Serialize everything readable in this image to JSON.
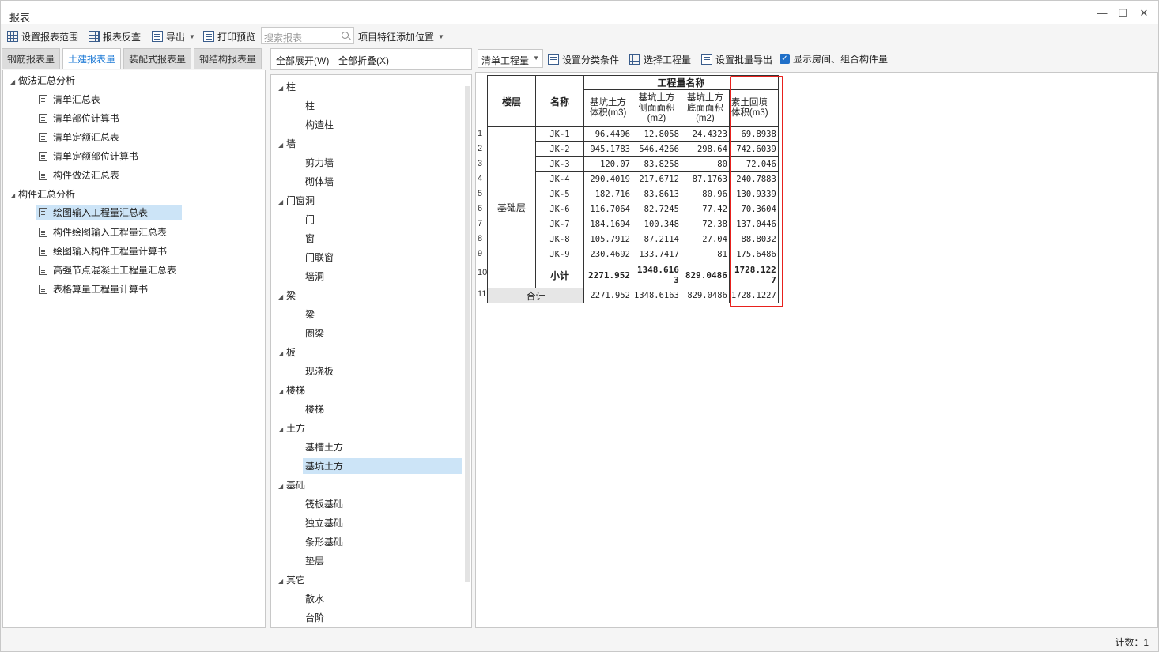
{
  "window": {
    "title": "报表",
    "minimize": "—",
    "maximize": "☐",
    "close": "✕"
  },
  "toolbar": {
    "set_range": "设置报表范围",
    "reverse_check": "报表反查",
    "export": "导出",
    "print_preview": "打印预览",
    "search_placeholder": "搜索报表",
    "add_feature_position": "项目特征添加位置"
  },
  "left_tabs": [
    "钢筋报表量",
    "土建报表量",
    "装配式报表量",
    "钢结构报表量"
  ],
  "left_tree": {
    "group1": "做法汇总分析",
    "group1_items": [
      "清单汇总表",
      "清单部位计算书",
      "清单定额汇总表",
      "清单定额部位计算书",
      "构件做法汇总表"
    ],
    "group2": "构件汇总分析",
    "group2_items": [
      "绘图输入工程量汇总表",
      "构件绘图输入工程量汇总表",
      "绘图输入构件工程量计算书",
      "高强节点混凝土工程量汇总表",
      "表格算量工程量计算书"
    ]
  },
  "middle": {
    "expand_all": "全部展开(W)",
    "collapse_all": "全部折叠(X)",
    "tree": [
      {
        "label": "柱",
        "children": [
          "柱",
          "构造柱"
        ]
      },
      {
        "label": "墙",
        "children": [
          "剪力墙",
          "砌体墙"
        ]
      },
      {
        "label": "门窗洞",
        "children": [
          "门",
          "窗",
          "门联窗",
          "墙洞"
        ]
      },
      {
        "label": "梁",
        "children": [
          "梁",
          "圈梁"
        ]
      },
      {
        "label": "板",
        "children": [
          "现浇板"
        ]
      },
      {
        "label": "楼梯",
        "children": [
          "楼梯"
        ]
      },
      {
        "label": "土方",
        "children": [
          "基槽土方",
          "基坑土方"
        ]
      },
      {
        "label": "基础",
        "children": [
          "筏板基础",
          "独立基础",
          "条形基础",
          "垫层"
        ]
      },
      {
        "label": "其它",
        "children": [
          "散水",
          "台阶"
        ]
      }
    ]
  },
  "right_toolbar": {
    "qty_type": "清单工程量",
    "set_category": "设置分类条件",
    "select_qty": "选择工程量",
    "set_batch_export": "设置批量导出",
    "show_rooms": "显示房间、组合构件量"
  },
  "report": {
    "h_floor": "楼层",
    "h_name": "名称",
    "h_group": "工程量名称",
    "h_c1": "基坑土方体积(m3)",
    "h_c2": "基坑土方侧面面积(m2)",
    "h_c3": "基坑土方底面面积(m2)",
    "h_c4": "素土回填体积(m3)",
    "floor": "基础层",
    "rows": [
      [
        "JK-1",
        "96.4496",
        "12.8058",
        "24.4323",
        "69.8938"
      ],
      [
        "JK-2",
        "945.1783",
        "546.4266",
        "298.64",
        "742.6039"
      ],
      [
        "JK-3",
        "120.07",
        "83.8258",
        "80",
        "72.046"
      ],
      [
        "JK-4",
        "290.4019",
        "217.6712",
        "87.1763",
        "240.7883"
      ],
      [
        "JK-5",
        "182.716",
        "83.8613",
        "80.96",
        "130.9339"
      ],
      [
        "JK-6",
        "116.7064",
        "82.7245",
        "77.42",
        "70.3604"
      ],
      [
        "JK-7",
        "184.1694",
        "100.348",
        "72.38",
        "137.0446"
      ],
      [
        "JK-8",
        "105.7912",
        "87.2114",
        "27.04",
        "88.8032"
      ],
      [
        "JK-9",
        "230.4692",
        "133.7417",
        "81",
        "175.6486"
      ]
    ],
    "subtotal_label": "小计",
    "subtotal": [
      "2271.952",
      "1348.6163",
      "829.0486",
      "1728.1227"
    ],
    "total_label": "合计",
    "total": [
      "2271.952",
      "1348.6163",
      "829.0486",
      "1728.1227"
    ]
  },
  "status": {
    "count": "计数：1"
  }
}
